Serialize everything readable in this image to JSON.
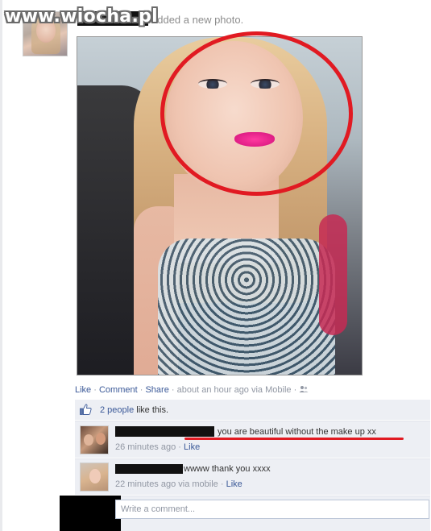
{
  "watermark": "www.wiocha.pl",
  "post": {
    "header_text": "added a new photo."
  },
  "actions": {
    "like": "Like",
    "comment": "Comment",
    "share": "Share",
    "sep": "·",
    "timestamp": "about an hour ago via Mobile"
  },
  "likes": {
    "count_link": "2 people",
    "rest": " like this."
  },
  "comments": [
    {
      "text": "you are beautiful without the make up xx",
      "time": "26 minutes ago",
      "like": "Like"
    },
    {
      "text": "wwww thank you xxxx",
      "time": "22 minutes ago via mobile",
      "like": "Like"
    }
  ],
  "composer": {
    "placeholder": "Write a comment..."
  },
  "colors": {
    "link": "#3b5998",
    "annotation_red": "#e11a22",
    "ufi_background": "#edeff4"
  },
  "icons": [
    "thumbs-up-icon",
    "mobile-icon",
    "audience-icon"
  ]
}
